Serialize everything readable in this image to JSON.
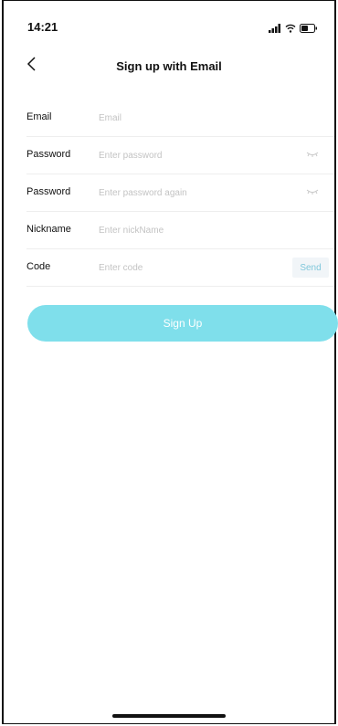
{
  "status_bar": {
    "time": "14:21"
  },
  "nav": {
    "title": "Sign up with Email",
    "back_icon": "chevron-left-icon"
  },
  "form": {
    "email": {
      "label": "Email",
      "placeholder": "Email",
      "value": ""
    },
    "password": {
      "label": "Password",
      "placeholder": "Enter password",
      "value": ""
    },
    "password_confirm": {
      "label": "Password",
      "placeholder": "Enter password again",
      "value": ""
    },
    "nickname": {
      "label": "Nickname",
      "placeholder": "Enter nickName",
      "value": ""
    },
    "code": {
      "label": "Code",
      "placeholder": "Enter code",
      "value": "",
      "send_label": "Send"
    }
  },
  "signup_button": {
    "label": "Sign Up"
  },
  "colors": {
    "accent": "#7fdfeb",
    "send_text": "#7fc7db",
    "placeholder": "#c3c3c3"
  }
}
